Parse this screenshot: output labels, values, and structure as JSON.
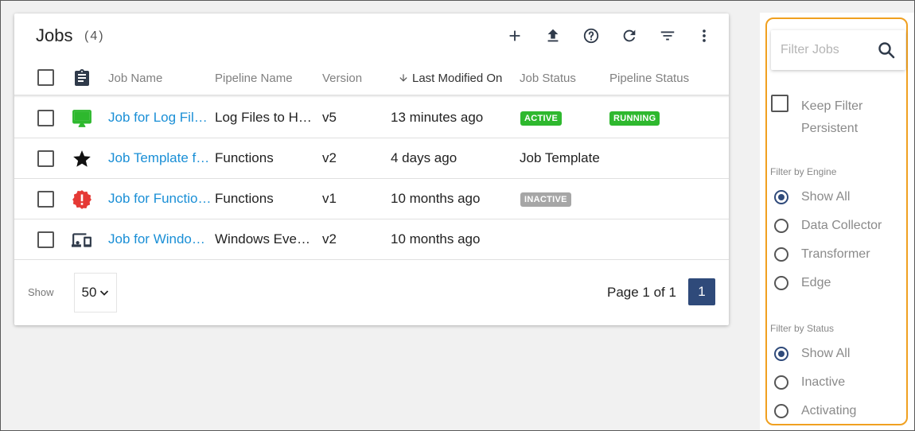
{
  "jobs_panel": {
    "title": "Jobs",
    "count": "(4)",
    "toolbar": [
      "add-icon",
      "upload-icon",
      "help-icon",
      "refresh-icon",
      "filter-icon",
      "more-vert-icon"
    ],
    "columns": {
      "job_name": "Job Name",
      "pipeline_name": "Pipeline Name",
      "version": "Version",
      "last_modified": "Last Modified On",
      "job_status": "Job Status",
      "pipeline_status": "Pipeline Status"
    },
    "rows": [
      {
        "icon": "monitor-icon",
        "job_name": "Job for Log Files to HDFS",
        "pipeline_name": "Log Files to HDFS",
        "version": "v5",
        "last_modified": "13 minutes ago",
        "job_status_badge": "ACTIVE",
        "job_status_text": "",
        "pipeline_status_badge": "RUNNING"
      },
      {
        "icon": "star-icon",
        "job_name": "Job Template for Functions",
        "pipeline_name": "Functions",
        "version": "v2",
        "last_modified": "4 days ago",
        "job_status_badge": "",
        "job_status_text": "Job Template",
        "pipeline_status_badge": ""
      },
      {
        "icon": "error-badge-icon",
        "job_name": "Job for Functions",
        "pipeline_name": "Functions",
        "version": "v1",
        "last_modified": "10 months ago",
        "job_status_badge": "INACTIVE",
        "job_status_text": "",
        "pipeline_status_badge": ""
      },
      {
        "icon": "devices-icon",
        "job_name": "Job for Windows Events",
        "pipeline_name": "Windows Events",
        "version": "v2",
        "last_modified": "10 months ago",
        "job_status_badge": "",
        "job_status_text": "",
        "pipeline_status_badge": ""
      }
    ],
    "footer": {
      "show_label": "Show",
      "page_size": "50",
      "page_text": "Page 1 of 1",
      "current_page": "1"
    }
  },
  "filter_panel": {
    "search_placeholder": "Filter Jobs",
    "keep_filter_label": "Keep Filter Persistent",
    "engine_title": "Filter by Engine",
    "engine_options": [
      "Show All",
      "Data Collector",
      "Transformer",
      "Edge"
    ],
    "engine_selected": "Show All",
    "status_title": "Filter by Status",
    "status_options": [
      "Show All",
      "Inactive",
      "Activating"
    ],
    "status_selected": "Show All"
  },
  "colors": {
    "link": "#1a8fd6",
    "active_badge": "#2eb82e",
    "inactive_badge": "#a6a6a6",
    "primary": "#2f4a7a",
    "highlight_border": "#f0a020",
    "error_icon": "#e53935",
    "monitor_icon": "#2eb82e"
  }
}
